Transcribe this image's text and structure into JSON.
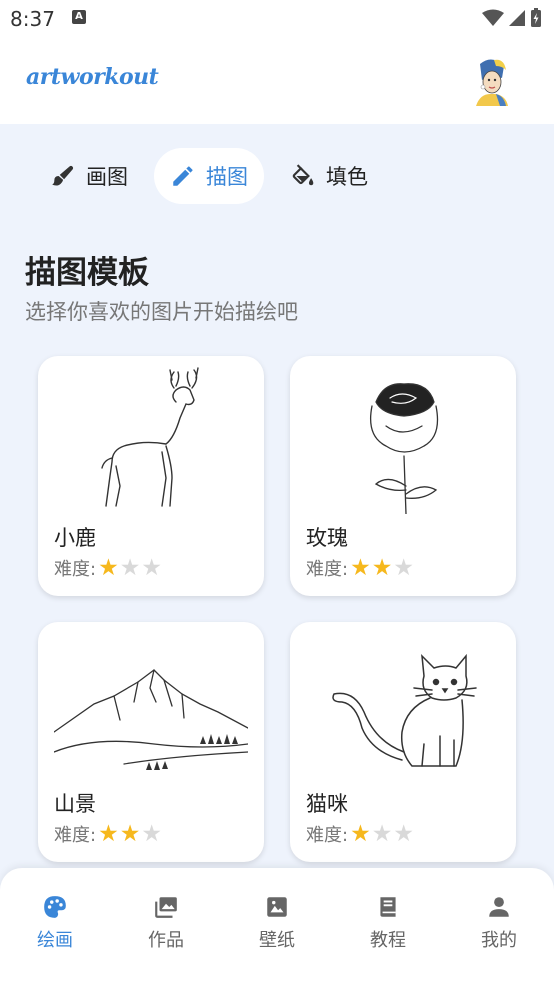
{
  "status_bar": {
    "time": "8:37",
    "notification_icon": "a-icon"
  },
  "header": {
    "logo_text": "artworkout"
  },
  "mode_tabs": [
    {
      "label": "画图",
      "icon": "brush-icon",
      "active": false
    },
    {
      "label": "描图",
      "icon": "pencil-icon",
      "active": true
    },
    {
      "label": "填色",
      "icon": "paint-bucket-icon",
      "active": false
    }
  ],
  "section": {
    "title": "描图模板",
    "subtitle": "选择你喜欢的图片开始描绘吧"
  },
  "difficulty_label": "难度:",
  "templates": [
    {
      "name": "小鹿",
      "difficulty": 1,
      "max": 3
    },
    {
      "name": "玫瑰",
      "difficulty": 2,
      "max": 3
    },
    {
      "name": "山景",
      "difficulty": 2,
      "max": 3
    },
    {
      "name": "猫咪",
      "difficulty": 1,
      "max": 3
    }
  ],
  "bottom_nav": [
    {
      "label": "绘画",
      "icon": "palette-icon",
      "active": true
    },
    {
      "label": "作品",
      "icon": "gallery-icon",
      "active": false
    },
    {
      "label": "壁纸",
      "icon": "image-icon",
      "active": false
    },
    {
      "label": "教程",
      "icon": "book-icon",
      "active": false
    },
    {
      "label": "我的",
      "icon": "person-icon",
      "active": false
    }
  ],
  "colors": {
    "accent": "#3a86d8",
    "star_on": "#f6b81d",
    "star_off": "#d9d9d9",
    "background": "#eef3fc"
  }
}
